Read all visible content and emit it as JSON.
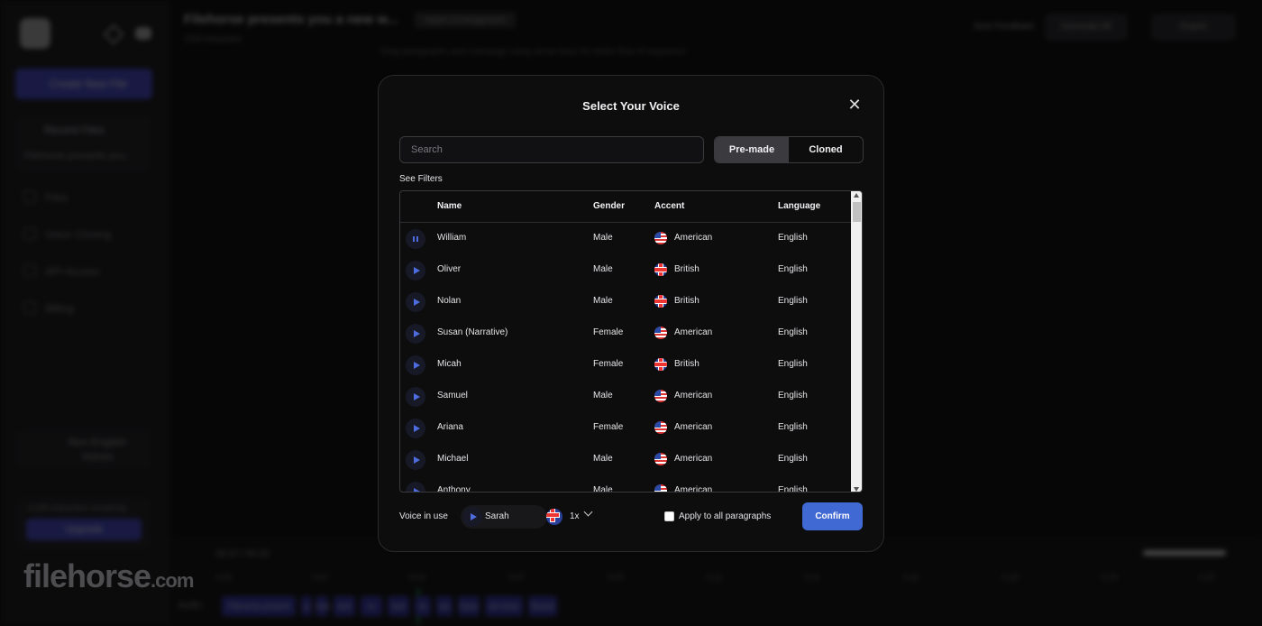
{
  "background": {
    "sidebar": {
      "create_label": "Create New File",
      "recent_label": "Recent Files",
      "recent_file": "Filehorse presents you...",
      "nav": [
        "Files",
        "Voice Cloning",
        "API Access",
        "Billing"
      ],
      "non_english_line1": "Non English",
      "non_english_line2": "Voices",
      "chars_remaining": "3,235 characters remaining",
      "upgrade_label": "Upgrade"
    },
    "topbar": {
      "doc_title": "Filehorse presents you a new w...",
      "doc_tag": "Import 1st Assignment",
      "doc_sub": "1234 characters",
      "feedback": "Give Feedback",
      "generate": "Generate All",
      "export": "Export"
    },
    "hint": "Drag paragraphs and rearrange using arrow keys for better flow of sequence",
    "timeline": {
      "time": "00:07 / 00:33",
      "track_label": "Audio",
      "ticks": [
        "0:00",
        "0:02",
        "0:04",
        "0:07",
        "0:09",
        "0:11",
        "0:14",
        "0:16",
        "0:18",
        "0:20",
        "0:23"
      ],
      "chips": [
        "Filehorse present",
        "a",
        "new",
        "text",
        "to",
        "fast",
        "to",
        "we",
        "Save",
        "all voice",
        "Boxed"
      ]
    },
    "watermark": "filehorse",
    "watermark_com": ".com"
  },
  "modal": {
    "title": "Select Your Voice",
    "search_placeholder": "Search",
    "tabs": [
      "Pre-made",
      "Cloned"
    ],
    "active_tab": "Pre-made",
    "see_filters": "See Filters",
    "columns": [
      "Name",
      "Gender",
      "Accent",
      "Language"
    ],
    "rows": [
      {
        "name": "William",
        "gender": "Male",
        "accent": "American",
        "flag": "us",
        "language": "English",
        "playing": true
      },
      {
        "name": "Oliver",
        "gender": "Male",
        "accent": "British",
        "flag": "uk",
        "language": "English"
      },
      {
        "name": "Nolan",
        "gender": "Male",
        "accent": "British",
        "flag": "uk",
        "language": "English"
      },
      {
        "name": "Susan (Narrative)",
        "gender": "Female",
        "accent": "American",
        "flag": "us",
        "language": "English"
      },
      {
        "name": "Micah",
        "gender": "Female",
        "accent": "British",
        "flag": "uk",
        "language": "English"
      },
      {
        "name": "Samuel",
        "gender": "Male",
        "accent": "American",
        "flag": "us",
        "language": "English"
      },
      {
        "name": "Ariana",
        "gender": "Female",
        "accent": "American",
        "flag": "us",
        "language": "English"
      },
      {
        "name": "Michael",
        "gender": "Male",
        "accent": "American",
        "flag": "us",
        "language": "English"
      },
      {
        "name": "Anthony",
        "gender": "Male",
        "accent": "American",
        "flag": "us",
        "language": "English"
      }
    ],
    "voice_in_use_label": "Voice in use",
    "voice_in_use": "Sarah",
    "voice_in_use_flag": "uk",
    "speed": "1x",
    "apply_all_label": "Apply to all paragraphs",
    "confirm_label": "Confirm",
    "accent_color": "#4169d3"
  }
}
